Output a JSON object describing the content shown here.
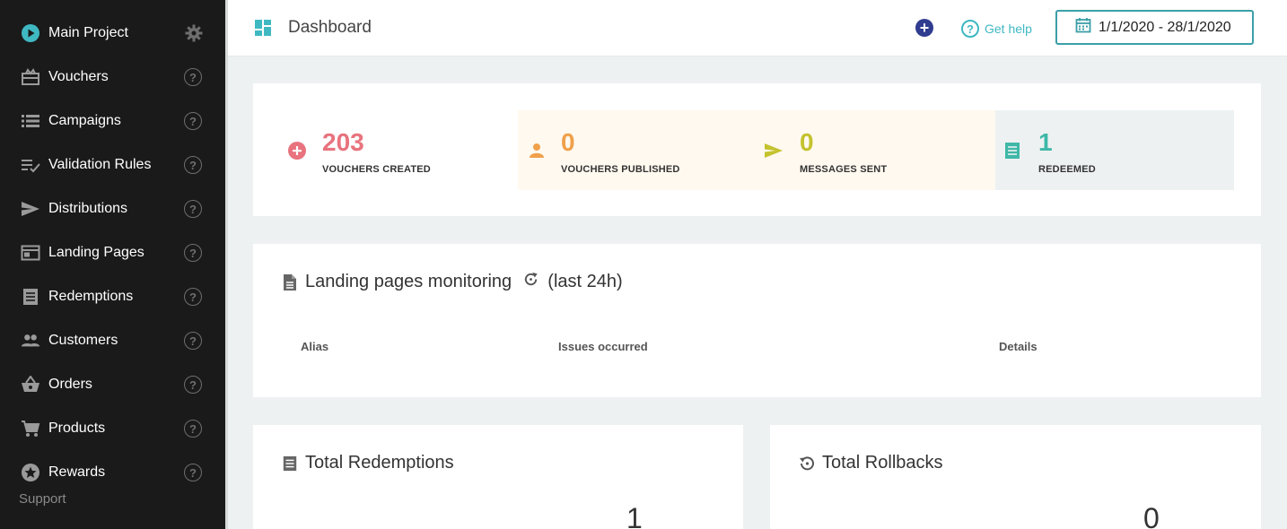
{
  "sidebar": {
    "items": [
      {
        "label": "Main Project",
        "icon": "play-circle-icon"
      },
      {
        "label": "Vouchers",
        "icon": "voucher-icon"
      },
      {
        "label": "Campaigns",
        "icon": "list-icon"
      },
      {
        "label": "Validation Rules",
        "icon": "checklist-icon"
      },
      {
        "label": "Distributions",
        "icon": "send-icon"
      },
      {
        "label": "Landing Pages",
        "icon": "web-page-icon"
      },
      {
        "label": "Redemptions",
        "icon": "receipt-icon"
      },
      {
        "label": "Customers",
        "icon": "people-icon"
      },
      {
        "label": "Orders",
        "icon": "basket-icon"
      },
      {
        "label": "Products",
        "icon": "cart-icon"
      },
      {
        "label": "Rewards",
        "icon": "star-icon"
      }
    ],
    "help_glyph": "?",
    "support_label": "Support"
  },
  "header": {
    "title": "Dashboard",
    "add_glyph": "+",
    "help_label": "Get help",
    "date_range": "1/1/2020 - 28/1/2020"
  },
  "stats": [
    {
      "value": "203",
      "caption": "VOUCHERS CREATED",
      "color": "#e8737e",
      "bg": "#ffffff",
      "icon": "plus-circle-icon"
    },
    {
      "value": "0",
      "caption": "VOUCHERS PUBLISHED",
      "color": "#f0a04b",
      "bg": "#fff9ef",
      "icon": "person-icon"
    },
    {
      "value": "0",
      "caption": "MESSAGES SENT",
      "color": "#c4c22e",
      "bg": "#fff9ef",
      "icon": "send-icon"
    },
    {
      "value": "1",
      "caption": "REDEEMED",
      "color": "#3fb8a8",
      "bg": "#eef1f2",
      "icon": "receipt-icon"
    }
  ],
  "monitoring": {
    "title": "Landing pages monitoring",
    "suffix": "(last 24h)",
    "columns": [
      "Alias",
      "Issues occurred",
      "Details"
    ]
  },
  "totals": [
    {
      "title": "Total Redemptions",
      "value": "1",
      "icon": "receipt-icon"
    },
    {
      "title": "Total Rollbacks",
      "value": "0",
      "icon": "history-icon"
    }
  ],
  "colors": {
    "accent": "#3fb8c2",
    "sidebar_bg": "#1a1a1a",
    "plus_button": "#2f3c8f"
  }
}
